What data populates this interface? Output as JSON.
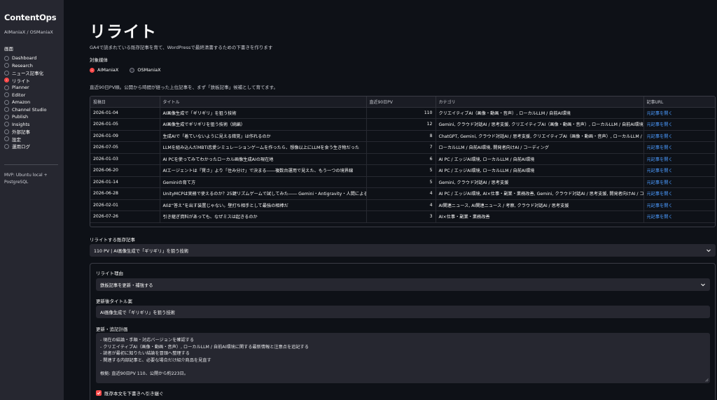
{
  "sidebar": {
    "brand": "ContentOps",
    "subbrand": "AIManiaX / OSManiaX",
    "nav_heading": "画面",
    "items": [
      {
        "label": "Dashboard",
        "selected": false
      },
      {
        "label": "Research",
        "selected": false
      },
      {
        "label": "ニュース記事化",
        "selected": false
      },
      {
        "label": "リライト",
        "selected": true
      },
      {
        "label": "Planner",
        "selected": false
      },
      {
        "label": "Editor",
        "selected": false
      },
      {
        "label": "Amazon",
        "selected": false
      },
      {
        "label": "Channel Studio",
        "selected": false
      },
      {
        "label": "Publish",
        "selected": false
      },
      {
        "label": "Insights",
        "selected": false
      },
      {
        "label": "外部記事",
        "selected": false
      },
      {
        "label": "設定",
        "selected": false
      },
      {
        "label": "運用ログ",
        "selected": false
      }
    ],
    "footer_line1": "MVP: Ubuntu local +",
    "footer_line2": "PostgreSQL"
  },
  "main": {
    "title": "リライト",
    "description": "GA4で読まれている既存記事を育て、WordPressで最終清書するための下書きを作ります",
    "media_label": "対象媒体",
    "media_options": [
      {
        "label": "AIManiaX",
        "selected": true
      },
      {
        "label": "OSManiaX",
        "selected": false
      }
    ],
    "note": "直近90日PV順。公開から時間が経った上位記事を、まず「鉄板記事」候補として育てます。"
  },
  "table": {
    "headers": [
      "投稿日",
      "タイトル",
      "直近90日PV",
      "カテゴリ",
      "記事URL"
    ],
    "rows": [
      {
        "date": "2026-01-04",
        "title": "AI画像生成で「ギリギリ」を狙う技術",
        "pv": "110",
        "category": "クリエイティブAI（画像・動画・音声）, ローカルLLM / 自前AI環境",
        "url": "元記事を開く"
      },
      {
        "date": "2026-01-05",
        "title": "AI画像生成でギリギリを狙う技術（続編）",
        "pv": "12",
        "category": "Gemini, クラウド対話AI / 思考支援, クリエイティブAI（画像・動画・音声）, ローカルLLM / 自前AI環境",
        "url": "元記事を開く"
      },
      {
        "date": "2026-01-09",
        "title": "生成AIで「着ていないように見える錯覚」は作れるのか",
        "pv": "8",
        "category": "ChatGPT, Gemini, クラウド対話AI / 思考支援, クリエイティブAI（画像・動画・音声）, ローカルLLM / 自前AI環境",
        "url": "元記事を開く"
      },
      {
        "date": "2026-07-05",
        "title": "LLMを組み込んだMBTI恋愛シミュレーションゲームを作ったら、想像以上にLLMを食う生き物だった",
        "pv": "7",
        "category": "ローカルLLM / 自前AI環境, 開発者向けAI / コーディング",
        "url": "元記事を開く"
      },
      {
        "date": "2026-01-03",
        "title": "AI PCを使ってみてわかったローカル画像生成AIの現在地",
        "pv": "6",
        "category": "AI PC / エッジAI環境, ローカルLLM / 自前AI環境",
        "url": "元記事を開く"
      },
      {
        "date": "2026-06-20",
        "title": "AIエージェントは「賢さ」より「住み分け」で決まる――複数台運用で見えた、もう一つの境界線",
        "pv": "5",
        "category": "AI PC / エッジAI環境, ローカルLLM / 自前AI環境",
        "url": "元記事を開く"
      },
      {
        "date": "2026-01-14",
        "title": "Geminiの育て方",
        "pv": "5",
        "category": "Gemini, クラウド対話AI / 思考支援",
        "url": "元記事を開く"
      },
      {
        "date": "2026-06-28",
        "title": "UnityMCPは実務で使えるのか？25鍵リズムゲームで試してみた―― Gemini・Antigravity・人間による共同開発",
        "pv": "4",
        "category": "AI PC / エッジAI環境, AI×仕事・副業・業務改善, Gemini, クラウド対話AI / 思考支援, 開発者向けAI / コーディング",
        "url": "元記事を開く"
      },
      {
        "date": "2026-02-01",
        "title": "AIは“答え”を出す装置じゃない。壁打ち相手として最強の相棒だ",
        "pv": "4",
        "category": "AI関連ニュース, AI関連ニュース / 考察, クラウド対話AI / 思考支援",
        "url": "元記事を開く"
      },
      {
        "date": "2026-07-26",
        "title": "引き継ぎ資料があっても、なぜミスは起きるのか",
        "pv": "3",
        "category": "AI×仕事・副業・業務改善",
        "url": "元記事を開く"
      }
    ]
  },
  "rewrite": {
    "select_label": "リライトする既存記事",
    "select_value": "110 PV | AI画像生成で「ギリギリ」を狙う技術",
    "reason_label": "リライト理由",
    "reason_value": "鉄板記事を更新・補強する",
    "title_label": "更新後タイトル案",
    "title_value": "AI画像生成で「ギリギリ」を狙う技術",
    "plan_label": "更新・追記計画",
    "plan_lines": [
      "- 現在の結論・手順・対応バージョンを確認する",
      "- クリエイティブAI（画像・動画・音声）, ローカルLLM / 自前AI環境に関する最新情報と注意点を追記する",
      "- 読者が最初に知りたい結論を冒頭へ整理する",
      "- 関連する内部記事と、必要な場合だけ紹介商品を見直す",
      "",
      "根拠: 直近90日PV 110、公開から約223日。"
    ],
    "checkbox_label": "既存本文を下書きへ引き継ぐ",
    "checkbox_checked": true
  },
  "colors": {
    "accent": "#ff4b4b",
    "link": "#4b9bff",
    "background": "#0e1117",
    "sidebar": "#262730"
  }
}
